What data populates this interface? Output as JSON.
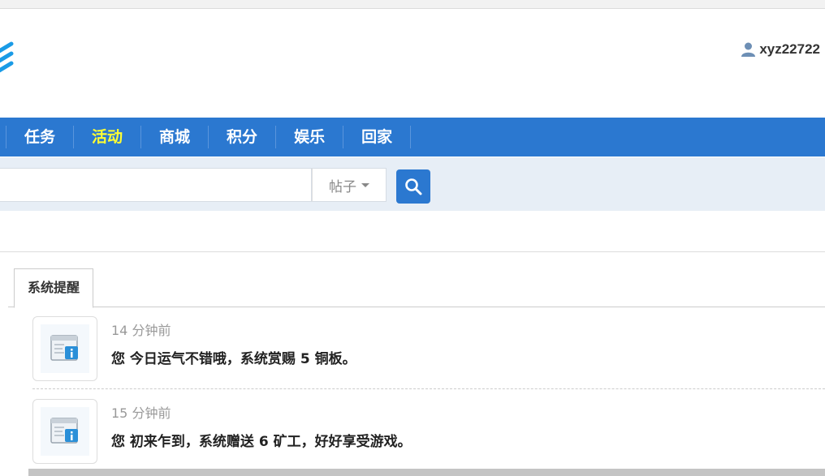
{
  "header": {
    "user_icon": "user-icon",
    "username": "xyz22722"
  },
  "nav": {
    "items": [
      {
        "label": "任务",
        "active": false
      },
      {
        "label": "活动",
        "active": true
      },
      {
        "label": "商城",
        "active": false
      },
      {
        "label": "积分",
        "active": false
      },
      {
        "label": "娱乐",
        "active": false
      },
      {
        "label": "回家",
        "active": false
      }
    ],
    "active_color": "#ffff33",
    "bg_color": "#2b78d0"
  },
  "search": {
    "type_selected": "帖子",
    "button_icon": "search-icon"
  },
  "tabs": {
    "system_notice": "系统提醒"
  },
  "notices": [
    {
      "time": "14 分钟前",
      "message": "您 今日运气不错哦，系统赏赐 5 铜板。",
      "icon": "info-window-icon"
    },
    {
      "time": "15 分钟前",
      "message": "您 初来乍到，系统赠送 6 矿工，好好享受游戏。",
      "icon": "info-window-icon"
    }
  ]
}
